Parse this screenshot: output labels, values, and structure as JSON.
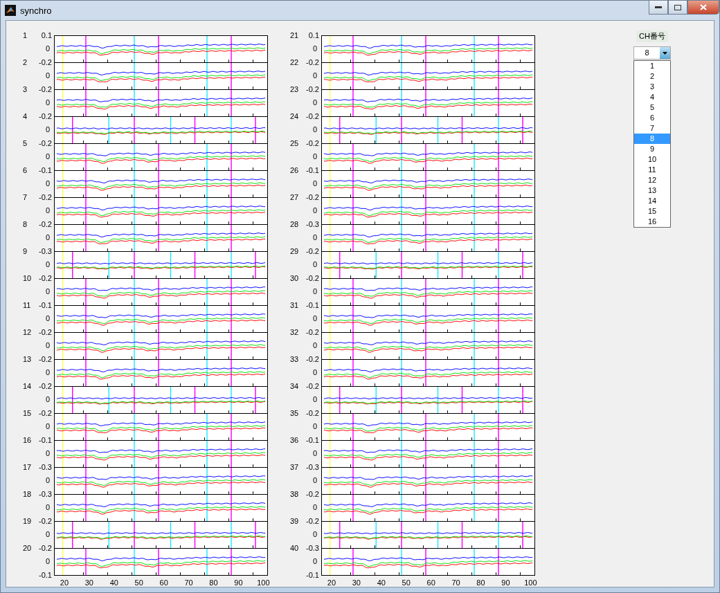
{
  "window": {
    "title": "synchro"
  },
  "columns": [
    {
      "panels": [
        {
          "label": "1",
          "top_tick": "0.1",
          "zero_tick": "0"
        },
        {
          "label": "2",
          "top_tick": "-0.2",
          "zero_tick": "0"
        },
        {
          "label": "3",
          "top_tick": "-0.2",
          "zero_tick": "0"
        },
        {
          "label": "4",
          "top_tick": "-0.2",
          "zero_tick": "0"
        },
        {
          "label": "5",
          "top_tick": "-0.2",
          "zero_tick": "0"
        },
        {
          "label": "6",
          "top_tick": "-0.1",
          "zero_tick": "0"
        },
        {
          "label": "7",
          "top_tick": "-0.2",
          "zero_tick": "0"
        },
        {
          "label": "8",
          "top_tick": "-0.2",
          "zero_tick": "0"
        },
        {
          "label": "9",
          "top_tick": "-0.3",
          "zero_tick": "0"
        },
        {
          "label": "10",
          "top_tick": "-0.2",
          "zero_tick": "0"
        },
        {
          "label": "11",
          "top_tick": "-0.1",
          "zero_tick": "0"
        },
        {
          "label": "12",
          "top_tick": "-0.2",
          "zero_tick": "0"
        },
        {
          "label": "13",
          "top_tick": "-0.2",
          "zero_tick": "0"
        },
        {
          "label": "14",
          "top_tick": "-0.2",
          "zero_tick": "0"
        },
        {
          "label": "15",
          "top_tick": "-0.2",
          "zero_tick": "0"
        },
        {
          "label": "16",
          "top_tick": "-0.1",
          "zero_tick": "0"
        },
        {
          "label": "17",
          "top_tick": "-0.3",
          "zero_tick": "0"
        },
        {
          "label": "18",
          "top_tick": "-0.3",
          "zero_tick": "0"
        },
        {
          "label": "19",
          "top_tick": "-0.2",
          "zero_tick": "0"
        },
        {
          "label": "20",
          "top_tick": "-0.2",
          "zero_tick": "0"
        }
      ],
      "bottom_tick": "-0.1",
      "xticks": [
        "20",
        "30",
        "40",
        "50",
        "60",
        "70",
        "80",
        "90",
        "100"
      ]
    },
    {
      "panels": [
        {
          "label": "21",
          "top_tick": "0.1",
          "zero_tick": "0"
        },
        {
          "label": "22",
          "top_tick": "-0.2",
          "zero_tick": "0"
        },
        {
          "label": "23",
          "top_tick": "-0.2",
          "zero_tick": "0"
        },
        {
          "label": "24",
          "top_tick": "-0.2",
          "zero_tick": "0"
        },
        {
          "label": "25",
          "top_tick": "-0.2",
          "zero_tick": "0"
        },
        {
          "label": "26",
          "top_tick": "-0.1",
          "zero_tick": "0"
        },
        {
          "label": "27",
          "top_tick": "-0.2",
          "zero_tick": "0"
        },
        {
          "label": "28",
          "top_tick": "-0.3",
          "zero_tick": "0"
        },
        {
          "label": "29",
          "top_tick": "-0.2",
          "zero_tick": "0"
        },
        {
          "label": "30",
          "top_tick": "-0.2",
          "zero_tick": "0"
        },
        {
          "label": "31",
          "top_tick": "-0.1",
          "zero_tick": "0"
        },
        {
          "label": "32",
          "top_tick": "-0.2",
          "zero_tick": "0"
        },
        {
          "label": "33",
          "top_tick": "-0.2",
          "zero_tick": "0"
        },
        {
          "label": "34",
          "top_tick": "-0.2",
          "zero_tick": "0"
        },
        {
          "label": "35",
          "top_tick": "-0.2",
          "zero_tick": "0"
        },
        {
          "label": "36",
          "top_tick": "-0.1",
          "zero_tick": "0"
        },
        {
          "label": "37",
          "top_tick": "-0.3",
          "zero_tick": "0"
        },
        {
          "label": "38",
          "top_tick": "-0.2",
          "zero_tick": "0"
        },
        {
          "label": "39",
          "top_tick": "-0.2",
          "zero_tick": "0"
        },
        {
          "label": "40",
          "top_tick": "-0.3",
          "zero_tick": "0"
        }
      ],
      "bottom_tick": "-0.1",
      "xticks": [
        "20",
        "30",
        "40",
        "50",
        "60",
        "70",
        "80",
        "90",
        "100"
      ]
    }
  ],
  "channel_select": {
    "label": "CH番号",
    "value": "8",
    "options": [
      {
        "label": "1",
        "selected": false
      },
      {
        "label": "2",
        "selected": false
      },
      {
        "label": "3",
        "selected": false
      },
      {
        "label": "4",
        "selected": false
      },
      {
        "label": "5",
        "selected": false
      },
      {
        "label": "6",
        "selected": false
      },
      {
        "label": "7",
        "selected": false
      },
      {
        "label": "8",
        "selected": true
      },
      {
        "label": "9",
        "selected": false
      },
      {
        "label": "10",
        "selected": false
      },
      {
        "label": "11",
        "selected": false
      },
      {
        "label": "12",
        "selected": false
      },
      {
        "label": "13",
        "selected": false
      },
      {
        "label": "14",
        "selected": false
      },
      {
        "label": "15",
        "selected": false
      },
      {
        "label": "16",
        "selected": false
      }
    ]
  }
}
